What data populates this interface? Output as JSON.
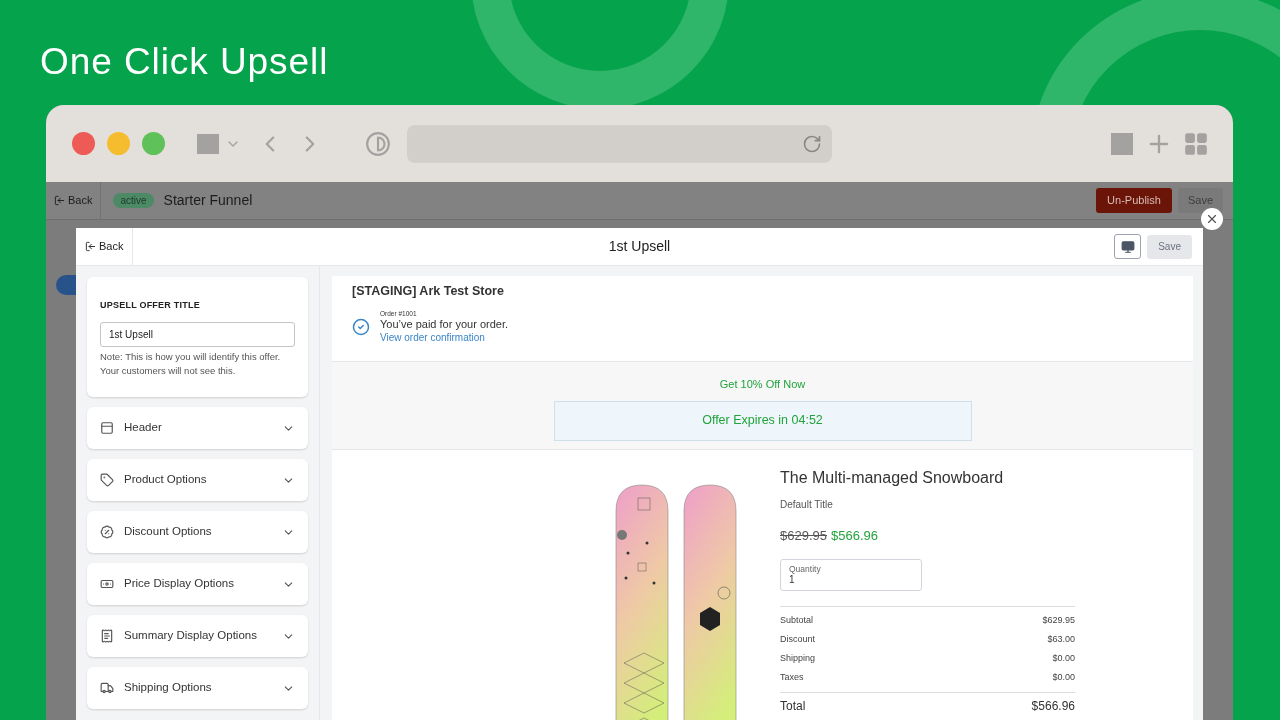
{
  "banner": {
    "title": "One Click Upsell"
  },
  "funnel_bar": {
    "back": "Back",
    "status": "active",
    "title": "Starter Funnel",
    "unpublish": "Un-Publish",
    "save": "Save"
  },
  "modal": {
    "back": "Back",
    "title": "1st Upsell",
    "save": "Save",
    "offer_title": {
      "label": "UPSELL OFFER TITLE",
      "value": "1st Upsell",
      "note": "Note: This is how you will identify this offer. Your customers will not see this."
    },
    "sections": [
      {
        "label": "Header",
        "expanded": false
      },
      {
        "label": "Product Options",
        "expanded": false
      },
      {
        "label": "Discount Options",
        "expanded": false
      },
      {
        "label": "Price Display Options",
        "expanded": false
      },
      {
        "label": "Summary Display Options",
        "expanded": false
      },
      {
        "label": "Shipping Options",
        "expanded": false
      }
    ]
  },
  "preview": {
    "store": "[STAGING] Ark Test Store",
    "order_number": "Order #1001",
    "paid": "You’ve paid for your order.",
    "confirmation_link": "View order confirmation",
    "offer_headline": "Get 10% Off Now",
    "timer": "Offer Expires in 04:52",
    "product": {
      "name": "The Multi-managed Snowboard",
      "variant": "Default Title",
      "old_price": "$629.95",
      "price": "$566.96",
      "quantity_label": "Quantity",
      "quantity": "1"
    },
    "summary": [
      {
        "label": "Subtotal",
        "value": "$629.95"
      },
      {
        "label": "Discount",
        "value": "$63.00"
      },
      {
        "label": "Shipping",
        "value": "$0.00"
      },
      {
        "label": "Taxes",
        "value": "$0.00"
      }
    ],
    "total": {
      "label": "Total",
      "value": "$566.96"
    }
  }
}
